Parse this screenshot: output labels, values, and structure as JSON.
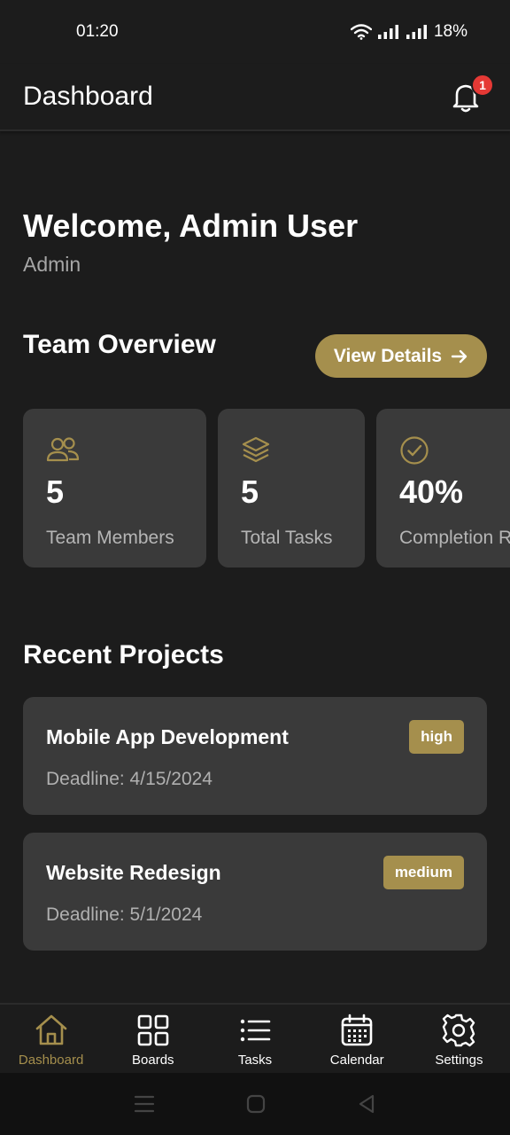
{
  "status_bar": {
    "time": "01:20",
    "battery": "18%"
  },
  "header": {
    "title": "Dashboard",
    "notification_count": "1"
  },
  "welcome": {
    "greeting": "Welcome, Admin User",
    "role": "Admin"
  },
  "team_overview": {
    "title": "Team Overview",
    "view_details_label": "View Details",
    "stats": [
      {
        "icon": "users-icon",
        "value": "5",
        "label": "Team Members"
      },
      {
        "icon": "layers-icon",
        "value": "5",
        "label": "Total Tasks"
      },
      {
        "icon": "check-circle-icon",
        "value": "40%",
        "label": "Completion Rate"
      }
    ]
  },
  "recent_projects": {
    "title": "Recent Projects",
    "items": [
      {
        "name": "Mobile App Development",
        "deadline": "Deadline: 4/15/2024",
        "priority": "high"
      },
      {
        "name": "Website Redesign",
        "deadline": "Deadline: 5/1/2024",
        "priority": "medium"
      }
    ]
  },
  "bottom_nav": [
    {
      "label": "Dashboard",
      "icon": "home-icon",
      "active": true
    },
    {
      "label": "Boards",
      "icon": "grid-icon",
      "active": false
    },
    {
      "label": "Tasks",
      "icon": "list-icon",
      "active": false
    },
    {
      "label": "Calendar",
      "icon": "calendar-icon",
      "active": false
    },
    {
      "label": "Settings",
      "icon": "gear-icon",
      "active": false
    }
  ],
  "colors": {
    "accent": "#a58f4d",
    "background": "#1c1c1c",
    "card": "#3a3a3a",
    "badge_red": "#e53935"
  }
}
